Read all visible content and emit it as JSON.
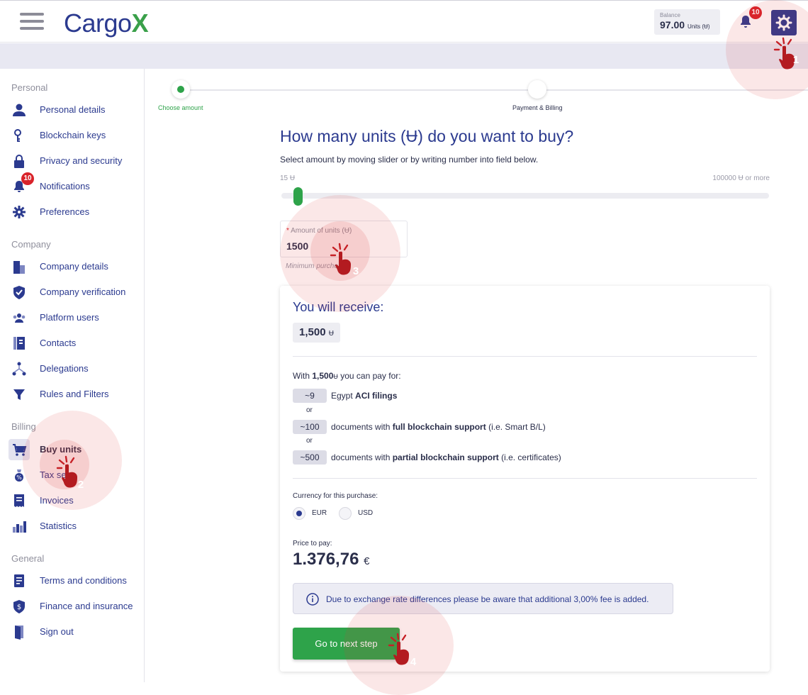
{
  "header": {
    "logo_text": "Cargo",
    "logo_x": "X",
    "balance_label": "Balance",
    "balance_value": "97.00",
    "balance_unit": "Units (Ʉ)",
    "notifications_count": "10"
  },
  "sidebar": {
    "sections": {
      "personal": "Personal",
      "company": "Company",
      "billing": "Billing",
      "general": "General"
    },
    "items": [
      {
        "label": "Personal details",
        "icon": "user-icon"
      },
      {
        "label": "Blockchain keys",
        "icon": "key-icon"
      },
      {
        "label": "Privacy and security",
        "icon": "lock-icon"
      },
      {
        "label": "Notifications",
        "icon": "bell-icon",
        "badge": "10"
      },
      {
        "label": "Preferences",
        "icon": "gear-icon"
      },
      {
        "label": "Company details",
        "icon": "building-icon"
      },
      {
        "label": "Company verification",
        "icon": "shield-check-icon"
      },
      {
        "label": "Platform users",
        "icon": "users-icon"
      },
      {
        "label": "Contacts",
        "icon": "address-book-icon"
      },
      {
        "label": "Delegations",
        "icon": "hierarchy-icon"
      },
      {
        "label": "Rules and Filters",
        "icon": "filter-icon"
      },
      {
        "label": "Buy units",
        "icon": "cart-icon",
        "active": true
      },
      {
        "label": "Tax se",
        "icon": "tax-icon"
      },
      {
        "label": "Invoices",
        "icon": "receipt-icon"
      },
      {
        "label": "Statistics",
        "icon": "bar-chart-icon"
      },
      {
        "label": "Terms and conditions",
        "icon": "document-icon"
      },
      {
        "label": "Finance and insurance",
        "icon": "dollar-shield-icon"
      },
      {
        "label": "Sign out",
        "icon": "door-icon"
      }
    ]
  },
  "stepper": {
    "step1": "Choose amount",
    "step2": "Payment & Billing"
  },
  "main": {
    "title": "How many units (Ʉ) do you want to buy?",
    "subtitle": "Select amount by moving slider or by writing number into field below.",
    "slider_min": "15 Ʉ",
    "slider_max": "100000 Ʉ or more",
    "slider_fraction": 0.015,
    "amount_label_star": "*",
    "amount_label": "Amount of units (Ʉ)",
    "amount_value": "1500",
    "min_note": "Minimum purche"
  },
  "card": {
    "receive_title": "You will receive:",
    "receive_value": "1,500",
    "unit_symbol": "Ʉ",
    "with_prefix": "With",
    "with_amount": "1,500",
    "with_suffix": "you can pay for:",
    "rows": [
      {
        "pill": "~9",
        "pre": "Egypt ",
        "bold": "ACI filings",
        "post": ""
      },
      {
        "pill": "~100",
        "pre": "documents with ",
        "bold": "full blockchain support",
        "post": " (i.e. Smart B/L)"
      },
      {
        "pill": "~500",
        "pre": "documents with ",
        "bold": "partial blockchain support",
        "post": " (i.e. certificates)"
      }
    ],
    "or": "or",
    "currency_label": "Currency for this purchase:",
    "currency_eur": "EUR",
    "currency_usd": "USD",
    "price_label": "Price to pay:",
    "price_value": "1.376,76",
    "price_currency": "€",
    "info_text": "Due to exchange rate differences please be aware that additional 3,00% fee is added.",
    "next_button": "Go to next step"
  },
  "annotations": [
    "1",
    "2",
    "3",
    "4"
  ],
  "colors": {
    "brand": "#2b3a8f",
    "accent_green": "#2ea34a",
    "badge_red": "#d9232a"
  }
}
